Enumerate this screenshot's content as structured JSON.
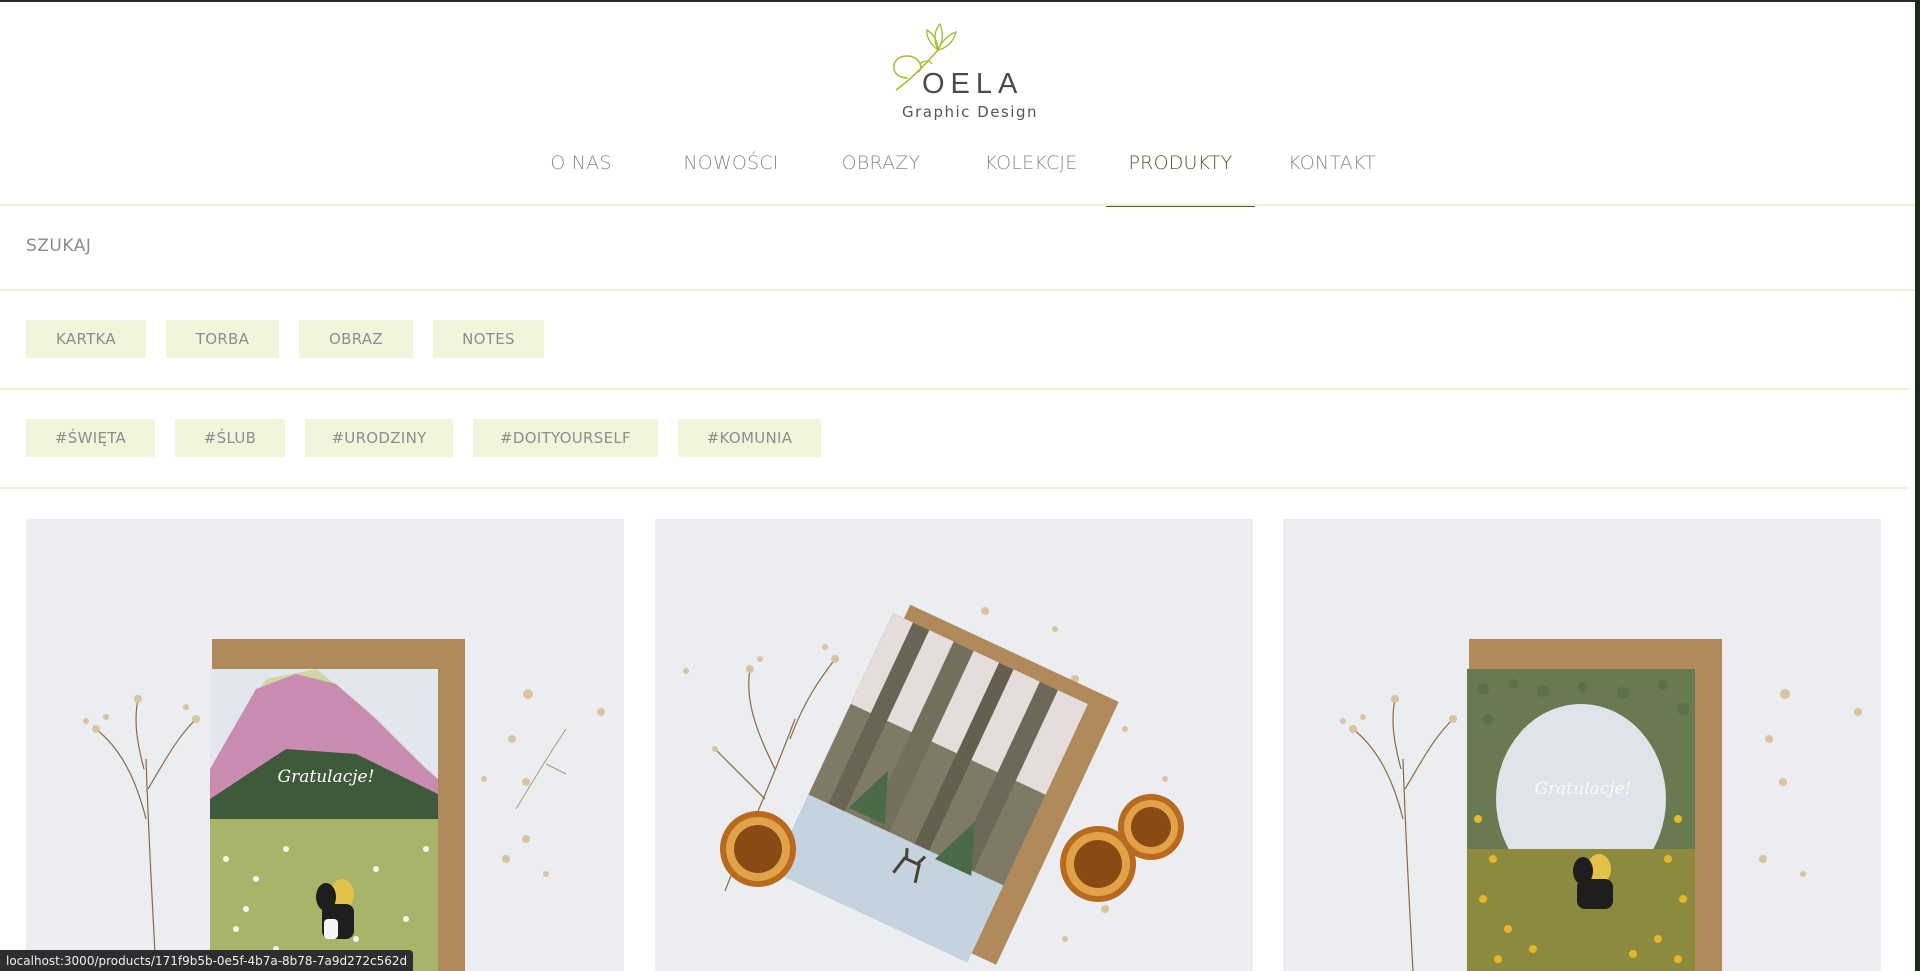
{
  "brand": {
    "name": "OELA",
    "tagline": "Graphic Design"
  },
  "nav": {
    "items": [
      {
        "label": "O NAS"
      },
      {
        "label": "NOWOŚCI"
      },
      {
        "label": "OBRAZY"
      },
      {
        "label": "KOLEKCJE"
      },
      {
        "label": "PRODUKTY",
        "active": true
      },
      {
        "label": "KONTAKT"
      }
    ]
  },
  "search": {
    "label": "SZUKAJ"
  },
  "categories": [
    "KARTKA",
    "TORBA",
    "OBRAZ",
    "NOTES"
  ],
  "tags": [
    "#ŚWIĘTA",
    "#ŚLUB",
    "#URODZINY",
    "#DOITYOURSELF",
    "#KOMUNIA"
  ],
  "products": [
    {
      "card_text": "Gratulacje!",
      "image": "mountain-meadow-card-icon"
    },
    {
      "card_text": "",
      "image": "forest-deer-card-icon"
    },
    {
      "card_text": "Gratulacje!",
      "image": "sunflower-field-card-icon"
    }
  ],
  "status_bar": {
    "url": "localhost:3000/products/171f9b5b-0e5f-4b7a-8b78-7a9d272c562d"
  },
  "colors": {
    "accent": "#4d5a2c",
    "chip_bg": "#f1f5dc",
    "divider": "#eef3d8",
    "logo_green": "#9cbf2a"
  }
}
